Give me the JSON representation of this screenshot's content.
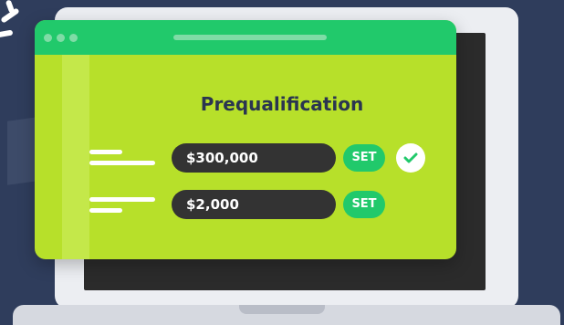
{
  "card": {
    "title": "Prequalification"
  },
  "rows": [
    {
      "value": "$300,000",
      "button_label": "SET",
      "confirmed": true
    },
    {
      "value": "$2,000",
      "button_label": "SET",
      "confirmed": false
    }
  ],
  "colors": {
    "background": "#2f3d5c",
    "card": "#b7e02a",
    "accent_green": "#21c96b",
    "field": "#333333",
    "title": "#2a3550"
  },
  "icons": [
    "check-icon",
    "window-dot-icon"
  ]
}
